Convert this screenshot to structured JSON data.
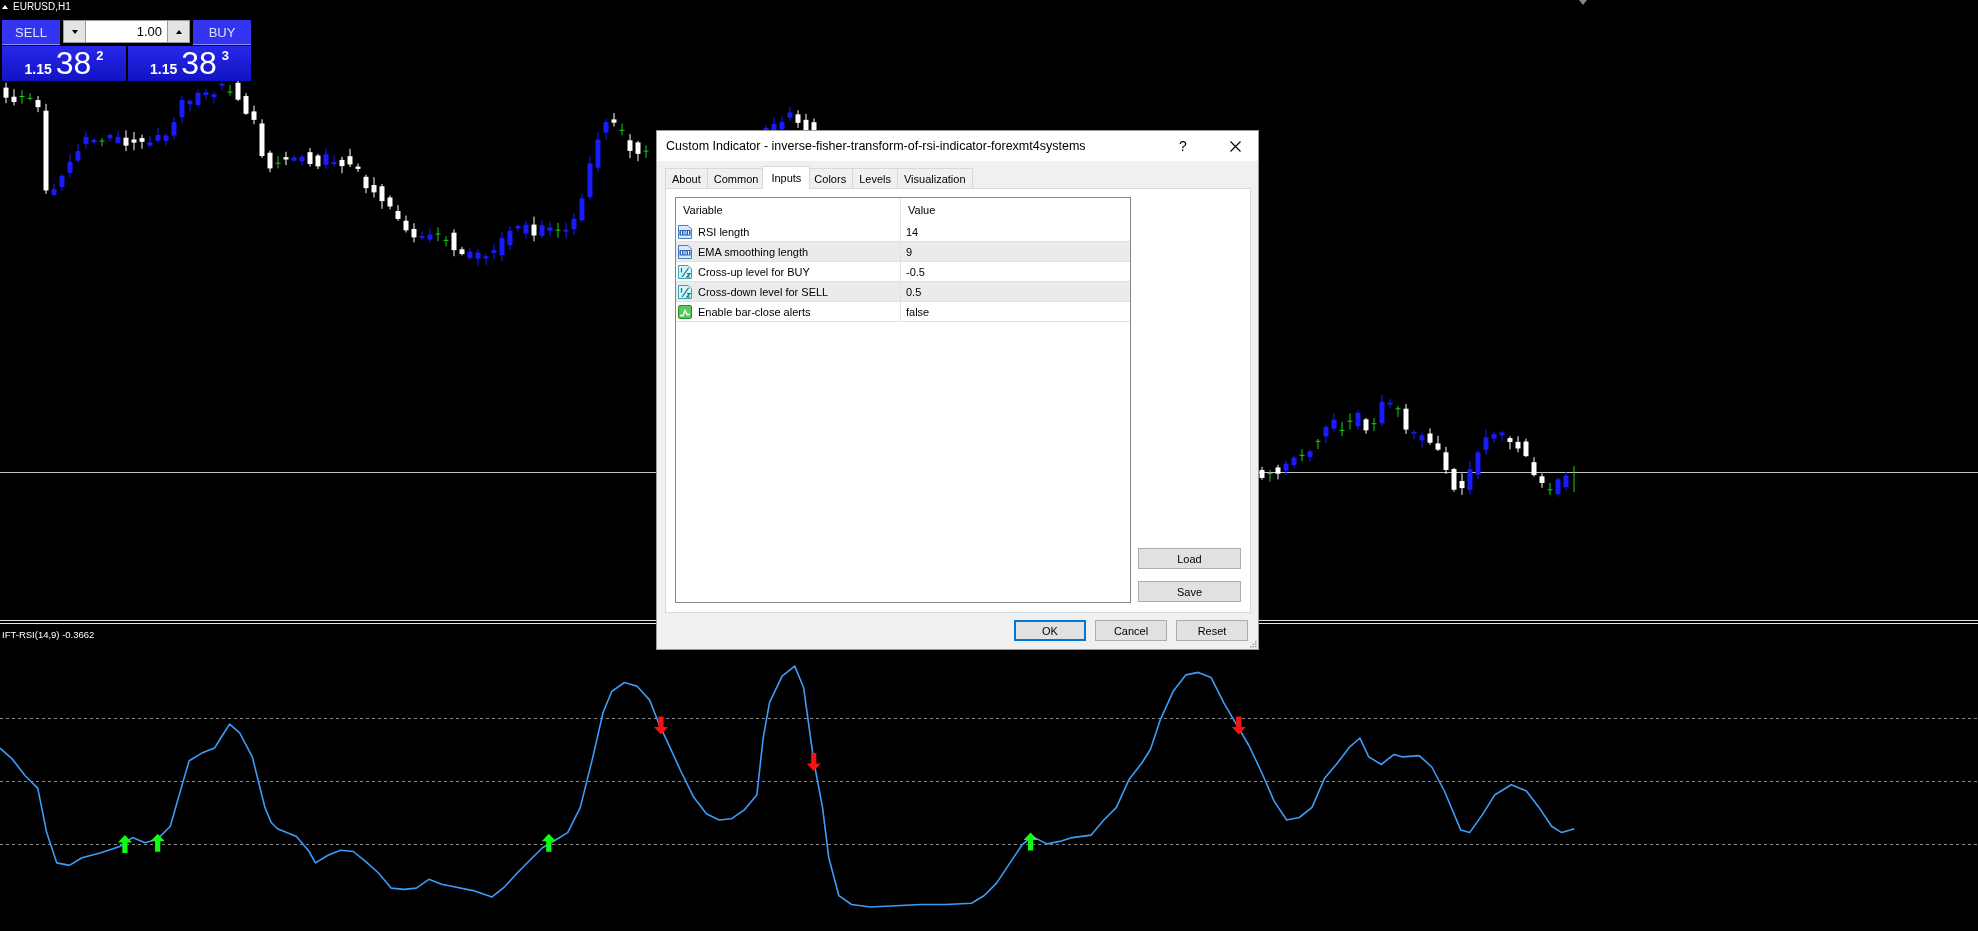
{
  "chart": {
    "symbol": "EURUSD,H1"
  },
  "trade_panel": {
    "sell_label": "SELL",
    "buy_label": "BUY",
    "volume": "1.00",
    "sell_price": {
      "prefix": "1.15",
      "pips": "38",
      "fraction": "2"
    },
    "buy_price": {
      "prefix": "1.15",
      "pips": "38",
      "fraction": "3"
    }
  },
  "indicator": {
    "label": "IFT-RSI(14,9) -0.3662"
  },
  "dialog": {
    "title": "Custom Indicator - inverse-fisher-transform-of-rsi-indicator-forexmt4systems",
    "help": "?",
    "tabs": [
      {
        "label": "About",
        "selected": false
      },
      {
        "label": "Common",
        "selected": false
      },
      {
        "label": "Inputs",
        "selected": true
      },
      {
        "label": "Colors",
        "selected": false
      },
      {
        "label": "Levels",
        "selected": false
      },
      {
        "label": "Visualization",
        "selected": false
      }
    ],
    "inputs": {
      "columns": [
        "Variable",
        "Value"
      ],
      "rows": [
        {
          "kind": "int",
          "variable": "RSI length",
          "value": "14"
        },
        {
          "kind": "int",
          "variable": "EMA smoothing length",
          "value": "9"
        },
        {
          "kind": "double",
          "variable": "Cross-up level for BUY",
          "value": "-0.5"
        },
        {
          "kind": "double",
          "variable": "Cross-down level for SELL",
          "value": "0.5"
        },
        {
          "kind": "bool",
          "variable": "Enable bar-close alerts",
          "value": "false"
        }
      ]
    },
    "side_buttons": [
      "Load",
      "Save"
    ],
    "buttons": [
      {
        "label": "OK",
        "default": true
      },
      {
        "label": "Cancel",
        "default": false
      },
      {
        "label": "Reset",
        "default": false
      }
    ]
  }
}
